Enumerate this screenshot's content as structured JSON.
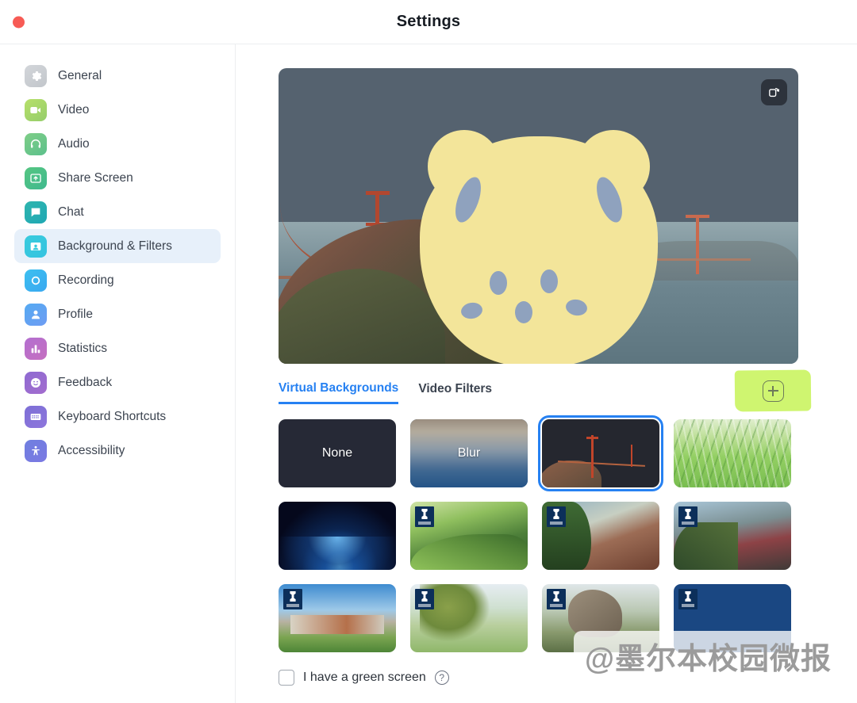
{
  "window": {
    "title": "Settings",
    "close_button": "close"
  },
  "sidebar": {
    "items": [
      {
        "label": "General",
        "icon": "gear-icon"
      },
      {
        "label": "Video",
        "icon": "video-camera-icon"
      },
      {
        "label": "Audio",
        "icon": "headphones-icon"
      },
      {
        "label": "Share Screen",
        "icon": "share-screen-icon"
      },
      {
        "label": "Chat",
        "icon": "chat-bubble-icon"
      },
      {
        "label": "Background & Filters",
        "icon": "background-person-icon"
      },
      {
        "label": "Recording",
        "icon": "record-circle-icon"
      },
      {
        "label": "Profile",
        "icon": "person-icon"
      },
      {
        "label": "Statistics",
        "icon": "bar-chart-icon"
      },
      {
        "label": "Feedback",
        "icon": "smiley-face-icon"
      },
      {
        "label": "Keyboard Shortcuts",
        "icon": "keyboard-icon"
      },
      {
        "label": "Accessibility",
        "icon": "accessibility-icon"
      }
    ],
    "active_index": 5
  },
  "preview": {
    "mirror_button_icon": "mirror-video-icon",
    "background_name": "Golden Gate Bridge",
    "avatar_overlay": "yellow-bear-sticker"
  },
  "tabs": [
    {
      "label": "Virtual Backgrounds",
      "active": true
    },
    {
      "label": "Video Filters",
      "active": false
    }
  ],
  "add_button": {
    "icon": "plus-icon",
    "highlight_color": "#c8f45c"
  },
  "backgrounds": [
    {
      "label": "None",
      "kind": "none",
      "selected": false,
      "badge": false
    },
    {
      "label": "Blur",
      "kind": "blur",
      "selected": false,
      "badge": false
    },
    {
      "label": "",
      "kind": "ggb",
      "selected": true,
      "badge": false
    },
    {
      "label": "",
      "kind": "grass",
      "selected": false,
      "badge": false
    },
    {
      "label": "",
      "kind": "earth",
      "selected": false,
      "badge": false
    },
    {
      "label": "",
      "kind": "garden",
      "selected": false,
      "badge": true
    },
    {
      "label": "",
      "kind": "bldg1",
      "selected": false,
      "badge": true
    },
    {
      "label": "",
      "kind": "bldg2",
      "selected": false,
      "badge": true
    },
    {
      "label": "",
      "kind": "campus1",
      "selected": false,
      "badge": true
    },
    {
      "label": "",
      "kind": "trees",
      "selected": false,
      "badge": true
    },
    {
      "label": "",
      "kind": "sculpt",
      "selected": false,
      "badge": true
    },
    {
      "label": "",
      "kind": "plain",
      "selected": false,
      "badge": true
    }
  ],
  "footer": {
    "green_screen_label": "I have a green screen",
    "help_icon": "question-mark-icon",
    "checked": false
  },
  "watermark": {
    "text": "@墨尔本校园微报"
  },
  "colors": {
    "accent": "#2681f2",
    "active_nav_bg": "#e7f0fa",
    "close_button": "#f75b55",
    "highlighter": "#c8f45c"
  }
}
